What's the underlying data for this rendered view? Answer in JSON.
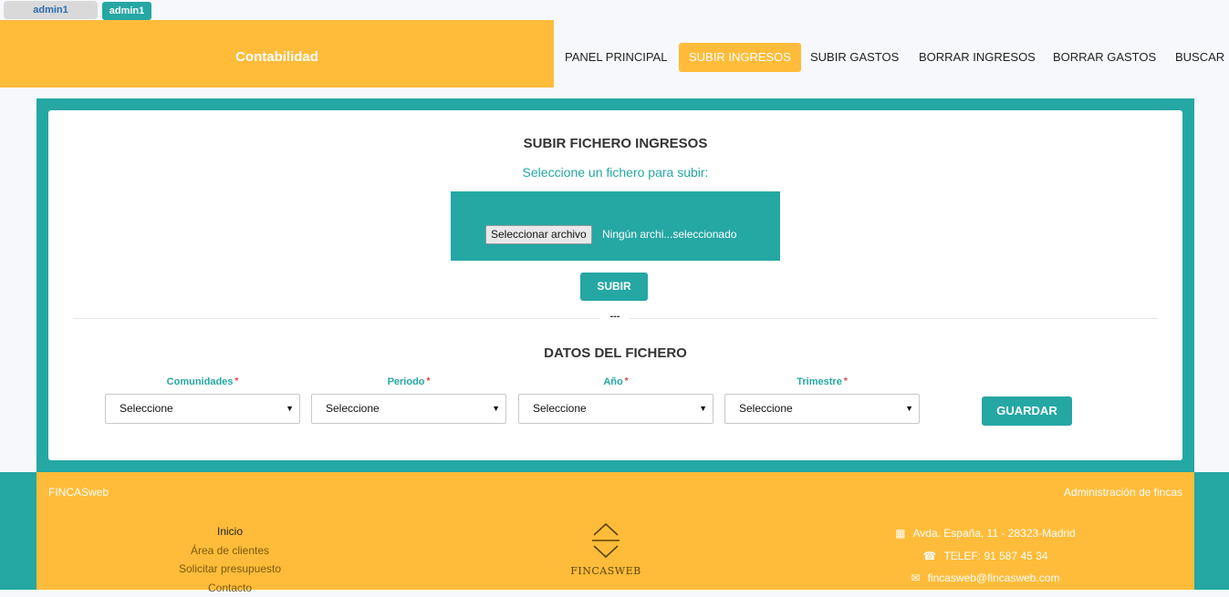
{
  "user": {
    "button_left": "admin1",
    "button_right": "admin1"
  },
  "header": {
    "brand": "Contabilidad",
    "nav": [
      {
        "label": "PANEL PRINCIPAL"
      },
      {
        "label": "SUBIR INGRESOS",
        "active": true
      },
      {
        "label": "SUBIR GASTOS"
      },
      {
        "label": "BORRAR INGRESOS"
      },
      {
        "label": "BORRAR GASTOS"
      },
      {
        "label": "BUSCAR"
      }
    ]
  },
  "upload": {
    "title": "SUBIR FICHERO INGRESOS",
    "subtitle": "Seleccione un fichero para subir:",
    "file_button": "Seleccionar archivo",
    "file_status": "Ningún archi...seleccionado",
    "submit": "SUBIR",
    "divider_mark": "---"
  },
  "data": {
    "title": "DATOS DEL FICHERO",
    "fields": [
      {
        "label": "Comunidades",
        "value": "Seleccione"
      },
      {
        "label": "Periodo",
        "value": "Seleccione"
      },
      {
        "label": "Año",
        "value": "Seleccione"
      },
      {
        "label": "Trimestre",
        "value": "Seleccione"
      }
    ],
    "required_mark": "*",
    "save": "GUARDAR"
  },
  "footer": {
    "brand": "FINCASweb",
    "tagline": "Administración de fincas",
    "links": [
      "Inicio",
      "Área de clientes",
      "Solicitar presupuesto",
      "Contacto"
    ],
    "logo_text": "FINCASWEB",
    "address": "Avda. España, 11 - 28323-Madrid",
    "phone": "TELEF: 91 587 45 34",
    "email": "fincasweb@fincasweb.com"
  },
  "colors": {
    "teal": "#25a7a4",
    "amber": "#ffbc3a"
  }
}
